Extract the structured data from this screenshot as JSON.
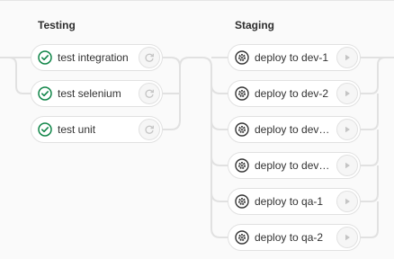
{
  "stages": [
    {
      "title": "Testing",
      "jobs": [
        {
          "name": "test integration",
          "status_icon": "success-check-icon",
          "action_icon": "retry-icon"
        },
        {
          "name": "test selenium",
          "status_icon": "success-check-icon",
          "action_icon": "retry-icon"
        },
        {
          "name": "test unit",
          "status_icon": "success-check-icon",
          "action_icon": "retry-icon"
        }
      ]
    },
    {
      "title": "Staging",
      "jobs": [
        {
          "name": "deploy to dev-1",
          "status_icon": "manual-gear-icon",
          "action_icon": "play-icon"
        },
        {
          "name": "deploy to dev-2",
          "status_icon": "manual-gear-icon",
          "action_icon": "play-icon"
        },
        {
          "name": "deploy to devo…",
          "status_icon": "manual-gear-icon",
          "action_icon": "play-icon"
        },
        {
          "name": "deploy to devo…",
          "status_icon": "manual-gear-icon",
          "action_icon": "play-icon"
        },
        {
          "name": "deploy to qa-1",
          "status_icon": "manual-gear-icon",
          "action_icon": "play-icon"
        },
        {
          "name": "deploy to qa-2",
          "status_icon": "manual-gear-icon",
          "action_icon": "play-icon"
        }
      ]
    }
  ],
  "colors": {
    "success": "#108548",
    "manual": "#333333",
    "connector": "#e1e1e1",
    "action_icon": "#c4c4c4"
  }
}
